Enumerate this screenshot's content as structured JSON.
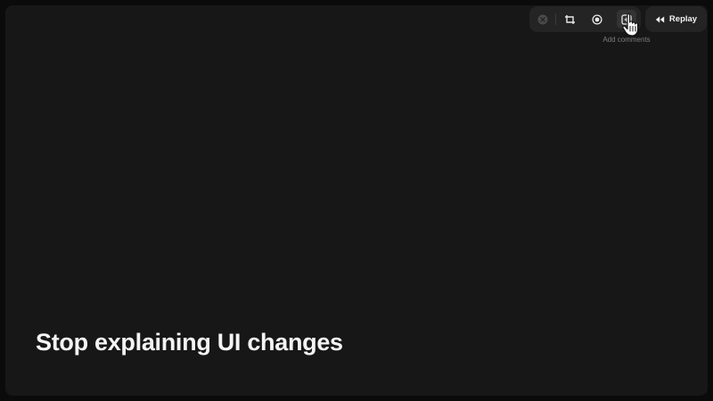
{
  "toolbar": {
    "tools": [
      {
        "icon": "close-circle-icon",
        "state": "disabled"
      },
      {
        "icon": "crop-area-icon"
      },
      {
        "icon": "record-icon"
      },
      {
        "icon": "add-comment-icon",
        "state": "hovered"
      }
    ],
    "tooltip": "Add comments"
  },
  "replay": {
    "icon": "rewind-icon",
    "label": "Replay"
  },
  "headline": "Stop explaining UI changes",
  "colors": {
    "background": "#171717",
    "toolbar": "#242424",
    "text": "#f4f4f4",
    "muted": "#7c7c7c"
  }
}
